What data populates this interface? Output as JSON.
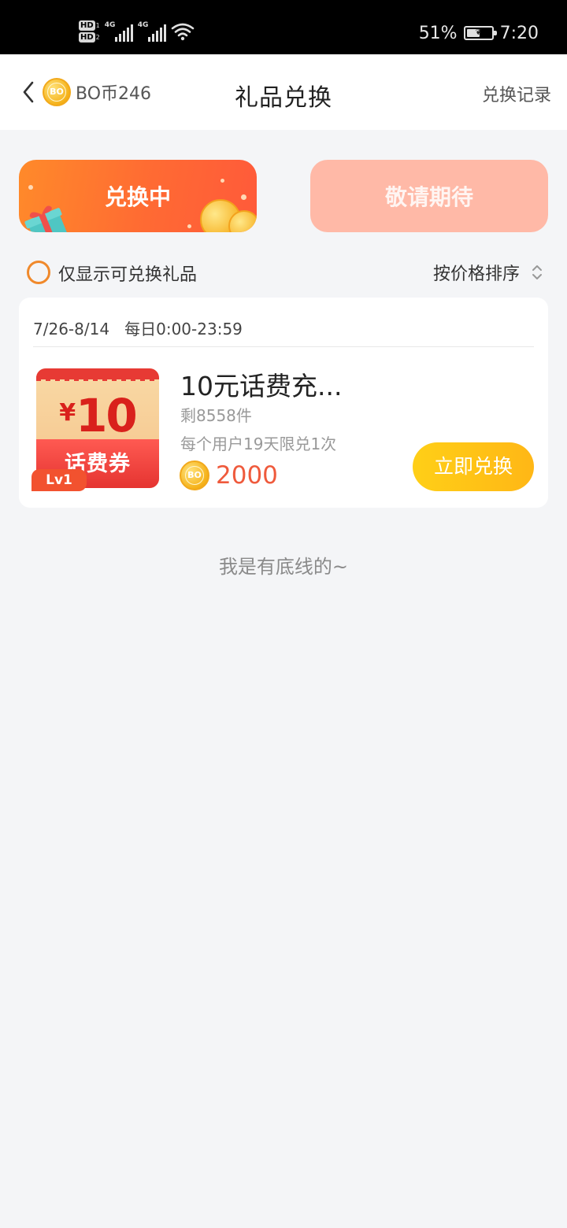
{
  "status_bar": {
    "sim1_badge": "HD",
    "sim1_index": "1",
    "sim2_badge": "HD",
    "sim2_index": "2",
    "sig1_label": "4G",
    "sig2_label": "4G",
    "battery_percent": "51%",
    "time": "7:20"
  },
  "header": {
    "coin_icon_text": "BO",
    "coin_balance": "BO币246",
    "title": "礼品兑换",
    "history_link": "兑换记录"
  },
  "tabs": [
    {
      "label": "兑换中",
      "active": true
    },
    {
      "label": "敬请期待",
      "active": false
    }
  ],
  "filter": {
    "only_available_label": "仅显示可兑换礼品",
    "only_available_checked": false,
    "sort_label": "按价格排序"
  },
  "gift_card": {
    "date_range": "7/26-8/14",
    "daily_time": "每日0:00-23:59",
    "voucher_currency": "¥",
    "voucher_amount": "10",
    "voucher_type": "话费券",
    "level_badge": "Lv1",
    "title": "10元话费充...",
    "stock": "剩8558件",
    "limit": "每个用户19天限兑1次",
    "price_coin_text": "BO",
    "price": "2000",
    "redeem_button": "立即兑换"
  },
  "footer_text": "我是有底线的~",
  "colors": {
    "accent_orange": "#ff6a33",
    "button_yellow": "#ffc316",
    "price_red": "#ef5a3c",
    "background": "#f4f5f7"
  }
}
